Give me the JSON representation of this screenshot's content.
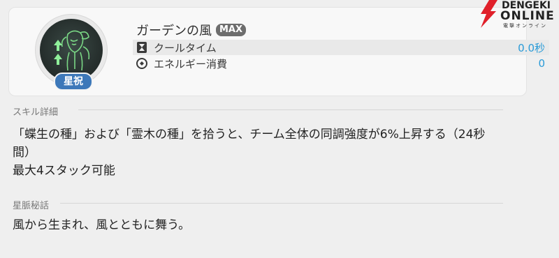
{
  "skill": {
    "name": "ガーデンの風",
    "level_badge": "MAX",
    "category_badge": "星祝",
    "stats": [
      {
        "label": "クールタイム",
        "value": "0.0秒",
        "icon": "hourglass-icon"
      },
      {
        "label": "エネルギー消費",
        "value": "0",
        "icon": "energy-icon"
      }
    ]
  },
  "sections": {
    "details_label": "スキル詳細",
    "details_lines": [
      "「蝶生の種」および「霊木の種」を拾うと、チーム全体の同調強度が6%上昇する（24秒",
      "間）",
      "最大4スタック可能"
    ],
    "lore_label": "星脈秘話",
    "lore_text": "風から生まれ、風とともに舞う。"
  },
  "logo": {
    "line1": "DENGEKI",
    "line2": "ONLINE",
    "line3": "電撃オンライン"
  },
  "colors": {
    "accent_value": "#2a9bd8",
    "badge_blue": "#3d78b9",
    "emblem_glow": "#7fe08a"
  }
}
